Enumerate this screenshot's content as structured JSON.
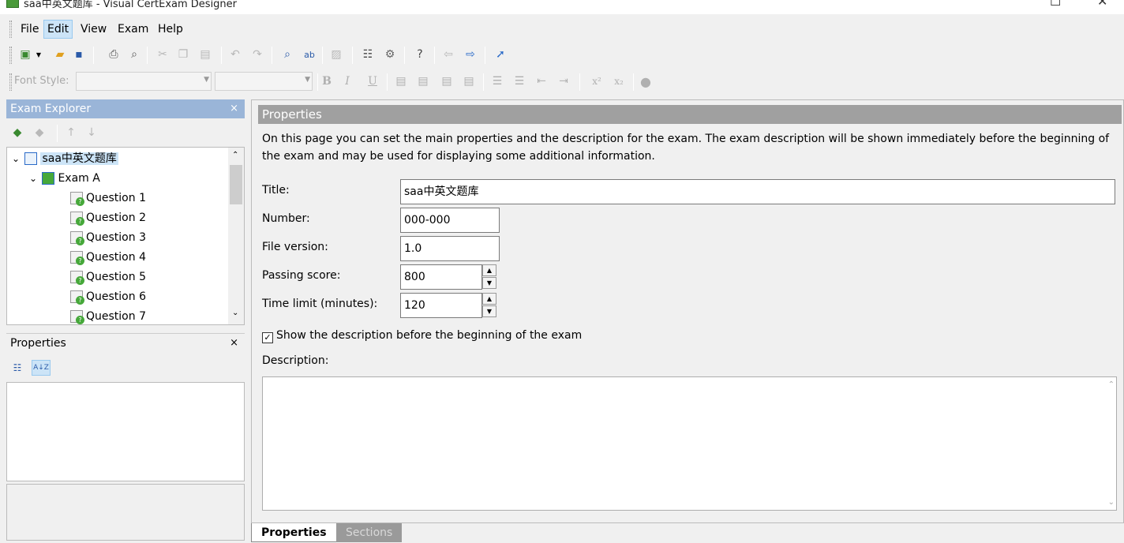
{
  "window": {
    "title": "saa中英文题库  - Visual CertExam Designer",
    "maximize_glyph": "☐",
    "close_glyph": "✕"
  },
  "menu": [
    {
      "label": "File",
      "active": false
    },
    {
      "label": "Edit",
      "active": true
    },
    {
      "label": "View",
      "active": false
    },
    {
      "label": "Exam",
      "active": false
    },
    {
      "label": "Help",
      "active": false
    }
  ],
  "format_bar": {
    "font_style_label": "Font Style:",
    "bold": "B",
    "italic": "I",
    "underline": "U",
    "superscript": "x²",
    "subscript": "x₂"
  },
  "explorer": {
    "title": "Exam Explorer",
    "close": "×",
    "tree": {
      "root": {
        "label": "saa中英文题库",
        "expander": "⌄"
      },
      "exam": {
        "label": "Exam A",
        "expander": "⌄"
      },
      "questions": [
        "Question 1",
        "Question 2",
        "Question 3",
        "Question 4",
        "Question 5",
        "Question 6",
        "Question 7"
      ]
    }
  },
  "properties_panel": {
    "title": "Properties",
    "close": "×",
    "sort_icon_label": "A↓Z"
  },
  "content": {
    "section_title": "Properties",
    "intro": "On this page you can set the main properties and the description for the exam. The exam description will be shown immediately before the beginning of the exam and may be used for displaying some additional information.",
    "fields": {
      "title": {
        "label": "Title:",
        "value": "saa中英文题库"
      },
      "number": {
        "label": "Number:",
        "value": "000-000"
      },
      "file_version": {
        "label": "File version:",
        "value": "1.0"
      },
      "passing_score": {
        "label": "Passing score:",
        "value": "800"
      },
      "time_limit": {
        "label": "Time limit (minutes):",
        "value": "120"
      }
    },
    "show_description": {
      "label": "Show the description before the beginning of the exam",
      "checked": true,
      "check_glyph": "✓"
    },
    "description_label": "Description:",
    "description_value": ""
  },
  "tabs": [
    {
      "label": "Properties",
      "active": true
    },
    {
      "label": "Sections",
      "active": false
    }
  ],
  "colors": {
    "explorer_header": "#9ab5d8",
    "section_header": "#a0a0a0",
    "selection": "#cce4f7",
    "question_badge": "#46a83a"
  }
}
